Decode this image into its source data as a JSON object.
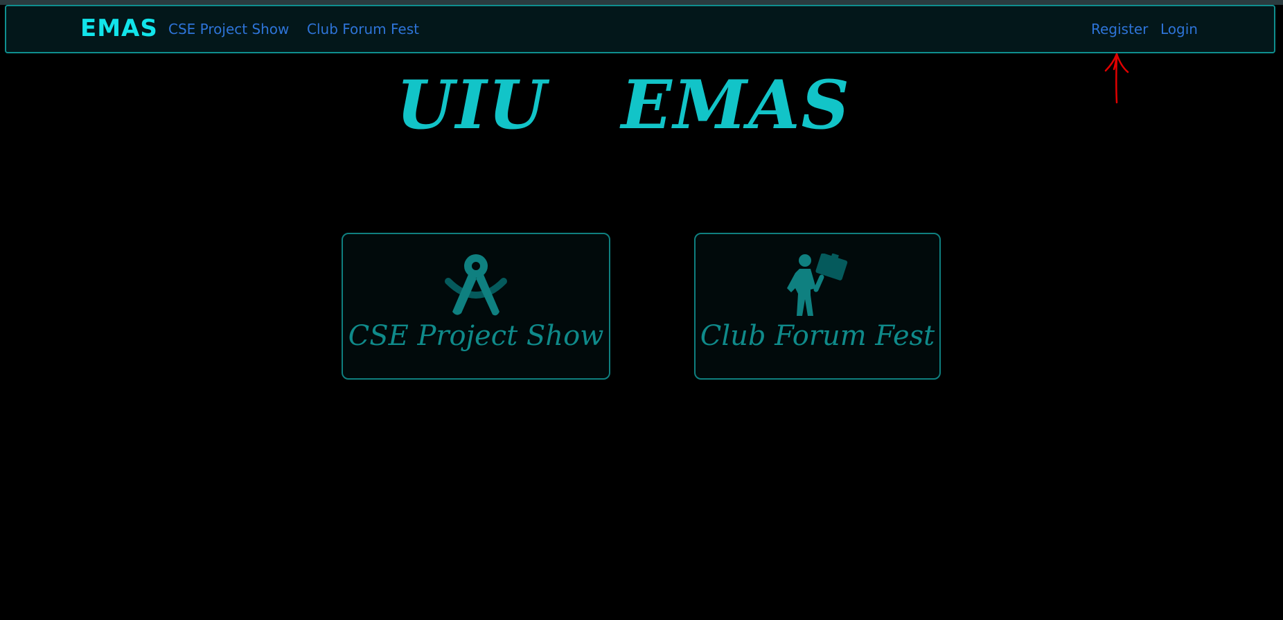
{
  "navbar": {
    "brand": "EMAS",
    "links": [
      {
        "label": "CSE Project Show"
      },
      {
        "label": "Club Forum Fest"
      }
    ],
    "auth": [
      {
        "label": "Register"
      },
      {
        "label": "Login"
      }
    ]
  },
  "hero": {
    "title": "UIU   EMAS"
  },
  "cards": [
    {
      "label": "CSE Project Show",
      "icon": "compass-icon"
    },
    {
      "label": "Club Forum Fest",
      "icon": "person-holding-sign-icon"
    }
  ],
  "colors": {
    "brand": "#12e4ea",
    "link": "#2e74d8",
    "accent": "#0f8a8a",
    "hero": "#12c4c8",
    "annotation": "#e00000"
  }
}
